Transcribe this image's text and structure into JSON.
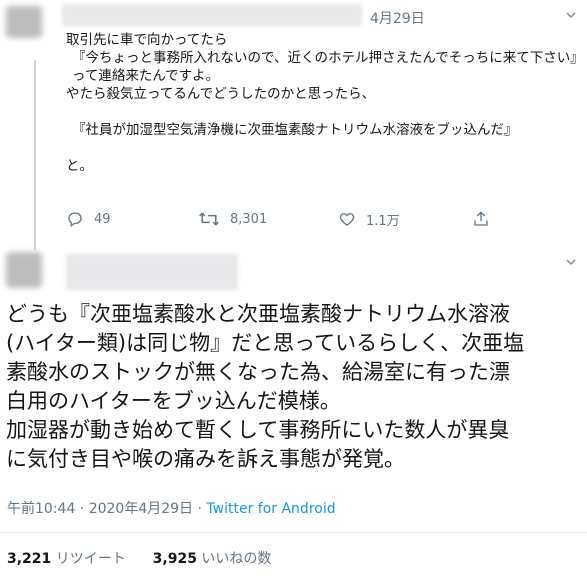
{
  "reply_tweet": {
    "date": "4月29日",
    "lines": [
      "取引先に車で向かってたら",
      "『今ちょっと事務所入れないので、近くのホテル押さえたんでそっちに来て下さい』",
      "って連絡来たんですよ。",
      "やたら殺気立ってるんでどうしたのかと思ったら、",
      "",
      "『社員が加湿型空気清浄機に次亜塩素酸ナトリウム水溶液をブッ込んだ』",
      "",
      "と。"
    ],
    "actions": {
      "reply_count": "49",
      "retweet_count": "8,301",
      "like_count": "1.1万"
    }
  },
  "main_tweet": {
    "lines": [
      "どうも『次亜塩素酸水と次亜塩素酸ナトリウム水溶液",
      "(ハイター類)は同じ物』だと思っているらしく、次亜塩",
      "素酸水のストックが無くなった為、給湯室に有った漂",
      "白用のハイターをブッ込んだ模様。",
      "加湿器が動き始めて暫くして事務所にいた数人が異臭",
      "に気付き目や喉の痛みを訴え事態が発覚。"
    ],
    "timestamp": "午前10:44 · 2020年4月29日 · ",
    "source": "Twitter for Android",
    "retweets": "3,221",
    "retweets_label": "リツイート",
    "likes": "3,925",
    "likes_label": "いいねの数"
  },
  "colors": {
    "text": "#14171a",
    "muted": "#657786",
    "link": "#1b95e0",
    "border": "#e6ecf0"
  },
  "icons": [
    "reply-icon",
    "retweet-icon",
    "like-icon",
    "share-icon",
    "chevron-down-icon"
  ]
}
